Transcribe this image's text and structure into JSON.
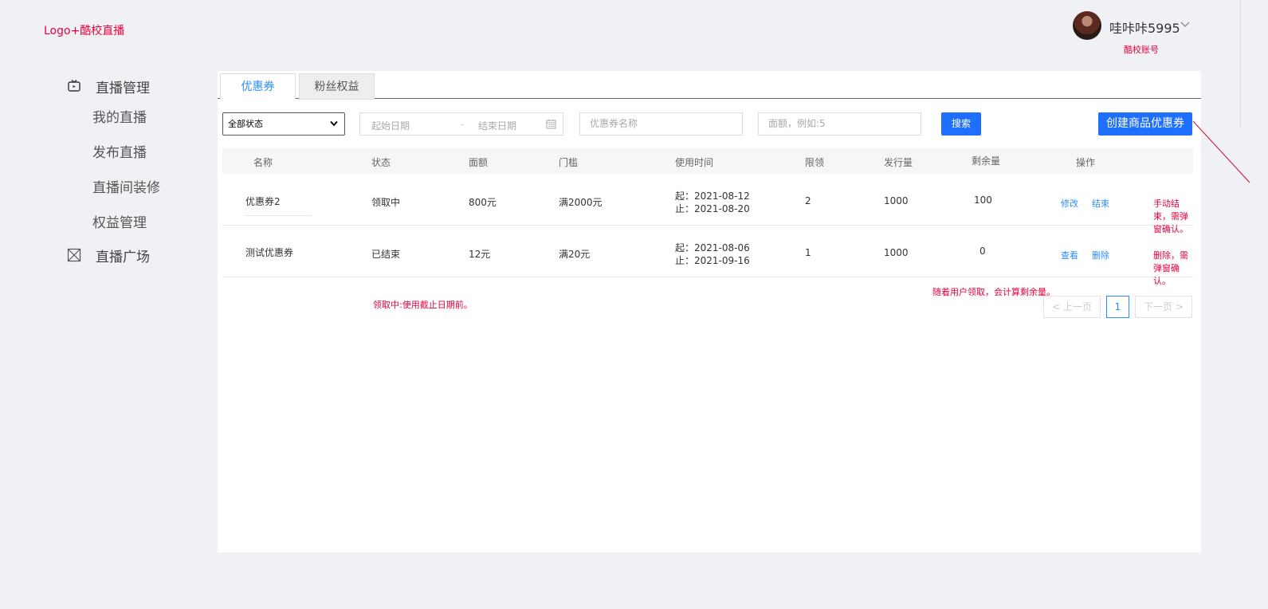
{
  "app": {
    "logo": "Logo+酷校直播"
  },
  "user": {
    "name": "哇咔咔5995",
    "account_note": "酷校账号"
  },
  "sidebar": {
    "section1": "直播管理",
    "items": [
      "我的直播",
      "发布直播",
      "直播间装修",
      "权益管理"
    ],
    "section2": "直播广场"
  },
  "tabs": [
    "优惠券",
    "粉丝权益"
  ],
  "filters": {
    "status_selected": "全部状态",
    "start_date_placeholder": "起始日期",
    "date_separator": "-",
    "end_date_placeholder": "结束日期",
    "coupon_name_placeholder": "优惠券名称",
    "amount_placeholder": "面额，例如:5",
    "search_label": "搜索",
    "create_label": "创建商品优惠券"
  },
  "table": {
    "headers": [
      "名称",
      "状态",
      "面额",
      "门槛",
      "使用时间",
      "限领",
      "发行量",
      "剩余量",
      "操作"
    ],
    "rows": [
      {
        "name": "优惠券2",
        "status": "领取中",
        "amount": "800元",
        "threshold": "满2000元",
        "time_start": "起：2021-08-12",
        "time_end": "止：2021-08-20",
        "limit": "2",
        "issued": "1000",
        "remaining": "100",
        "actions": [
          "修改",
          "结束"
        ],
        "note": "手动结束，需弹窗确认。"
      },
      {
        "name": "测试优惠券",
        "status": "已结束",
        "amount": "12元",
        "threshold": "满20元",
        "time_start": "起：2021-08-06",
        "time_end": "止：2021-09-16",
        "limit": "1",
        "issued": "1000",
        "remaining": "0",
        "actions": [
          "查看",
          "删除"
        ],
        "note": "删除，需弹窗确认。"
      }
    ]
  },
  "annotations": {
    "status_note": "领取中:使用截止日期前。",
    "remaining_note": "随着用户领取，会计算剩余量。"
  },
  "pagination": {
    "prev": "上一页",
    "current": "1",
    "next": "下一页"
  },
  "colors": {
    "accent": "#1f6fff",
    "annotation": "#e8003d",
    "link": "#2a8cff"
  }
}
